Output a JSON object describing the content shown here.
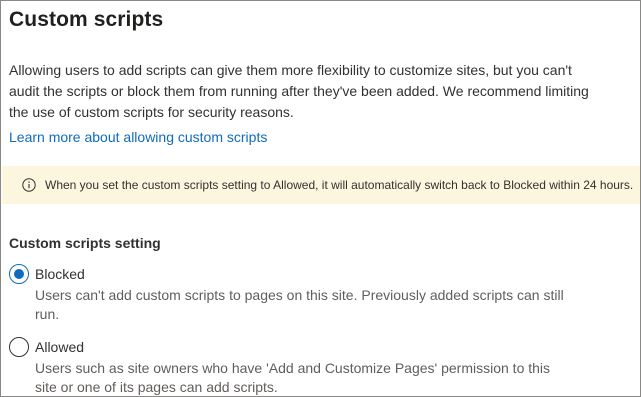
{
  "title": "Custom scripts",
  "description": "Allowing users to add scripts can give them more flexibility to customize sites, but you can't audit the scripts or block them from running after they've been added. We recommend limiting the use of custom scripts for security reasons.",
  "learn_more_link": "Learn more about allowing custom scripts",
  "message_bar": {
    "icon": "info-icon",
    "text": "When you set the custom scripts setting to Allowed, it will automatically switch back to Blocked within 24 hours.",
    "background": "#fdf6df"
  },
  "setting": {
    "label": "Custom scripts setting",
    "selected": "Blocked",
    "options": [
      {
        "label": "Blocked",
        "description": "Users can't add custom scripts to pages on this site. Previously added scripts can still run.",
        "checked": true
      },
      {
        "label": "Allowed",
        "description": "Users such as site owners who have 'Add and Customize Pages' permission to this site or one of its pages can add scripts.",
        "checked": false
      }
    ]
  },
  "colors": {
    "accent": "#0f6cbd",
    "text": "#323130",
    "secondary_text": "#605e5c",
    "border": "#8a8886"
  }
}
